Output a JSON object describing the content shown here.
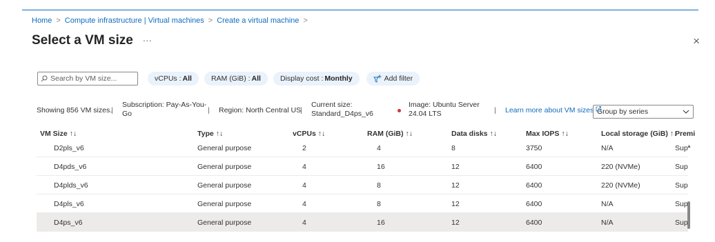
{
  "breadcrumb": {
    "home": "Home",
    "compute": "Compute infrastructure | Virtual machines",
    "create": "Create a virtual machine",
    "separator": ">"
  },
  "title": "Select a VM size",
  "more_label": "···",
  "close_label": "×",
  "filters": {
    "search_placeholder": "Search by VM size...",
    "vcpus_label": "vCPUs :",
    "vcpus_value": "All",
    "ram_label": "RAM (GiB) :",
    "ram_value": "All",
    "display_cost_label": "Display cost :",
    "display_cost_value": "Monthly",
    "add_filter": "Add filter"
  },
  "info": {
    "showing": "Showing 856 VM sizes.",
    "subscription_1": "Subscription: Pay-As-You-",
    "subscription_2": "Go",
    "region": "Region: North Central US",
    "current_size_1": "Current size:",
    "current_size_2": "Standard_D4ps_v6",
    "image_1": "Image: Ubuntu Server",
    "image_2": "24.04 LTS",
    "learn_more": "Learn more about VM sizes",
    "group_by": "Group by series",
    "pipe": "|"
  },
  "table": {
    "headers": {
      "size": "VM Size ↑↓",
      "type": "Type ↑↓",
      "vcpus": "vCPUs ↑↓",
      "ram": "RAM (GiB) ↑↓",
      "disks": "Data disks ↑↓",
      "iops": "Max IOPS ↑↓",
      "storage": "Local storage (GiB) ↑↓",
      "premium": "Premi"
    },
    "rows": [
      {
        "size": "D2pls_v6",
        "type": "General purpose",
        "vcpus": "2",
        "ram": "4",
        "disks": "8",
        "iops": "3750",
        "storage": "N/A",
        "premium": "Sup"
      },
      {
        "size": "D4pds_v6",
        "type": "General purpose",
        "vcpus": "4",
        "ram": "16",
        "disks": "12",
        "iops": "6400",
        "storage": "220 (NVMe)",
        "premium": "Sup"
      },
      {
        "size": "D4plds_v6",
        "type": "General purpose",
        "vcpus": "4",
        "ram": "8",
        "disks": "12",
        "iops": "6400",
        "storage": "220 (NVMe)",
        "premium": "Sup"
      },
      {
        "size": "D4pls_v6",
        "type": "General purpose",
        "vcpus": "4",
        "ram": "8",
        "disks": "12",
        "iops": "6400",
        "storage": "N/A",
        "premium": "Sup"
      },
      {
        "size": "D4ps_v6",
        "type": "General purpose",
        "vcpus": "4",
        "ram": "16",
        "disks": "12",
        "iops": "6400",
        "storage": "N/A",
        "premium": "Sup"
      }
    ]
  },
  "colors": {
    "accent": "#0f6cbd",
    "pill_bg": "#eaf2fb",
    "selected_row": "#edebe9",
    "red_dot": "#d13438"
  },
  "icons": {
    "search": "search-icon",
    "add_filter": "add-filter-icon",
    "external_link": "external-link-icon",
    "chevron": "chevron-down-icon"
  }
}
